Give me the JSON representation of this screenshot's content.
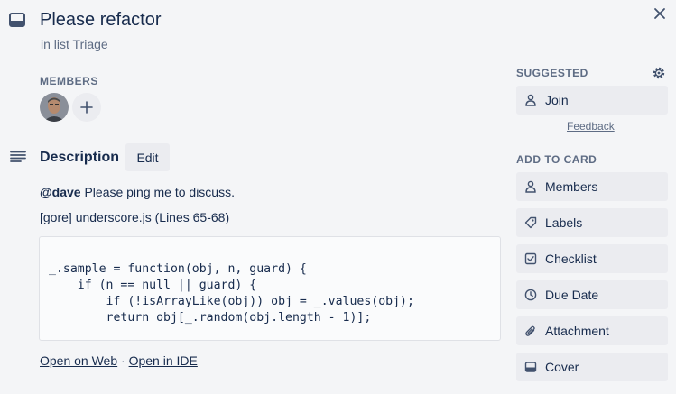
{
  "card": {
    "title": "Please refactor",
    "list_prefix": "in list",
    "list_name": "Triage"
  },
  "members": {
    "label": "MEMBERS"
  },
  "description": {
    "title": "Description",
    "edit_label": "Edit",
    "mention": "@dave",
    "message": "Please ping me to discuss.",
    "source_line": "[gore] underscore.js (Lines 65-68)",
    "code": "_.sample = function(obj, n, guard) {\n    if (n == null || guard) {\n        if (!isArrayLike(obj)) obj = _.values(obj);\n        return obj[_.random(obj.length - 1)];",
    "open_web": "Open on Web",
    "separator": "·",
    "open_ide": "Open in IDE"
  },
  "sidebar": {
    "suggested_label": "SUGGESTED",
    "join_label": "Join",
    "feedback_label": "Feedback",
    "add_to_card_label": "ADD TO CARD",
    "items": [
      {
        "label": "Members",
        "icon": "person-icon"
      },
      {
        "label": "Labels",
        "icon": "tag-icon"
      },
      {
        "label": "Checklist",
        "icon": "checklist-icon"
      },
      {
        "label": "Due Date",
        "icon": "clock-icon"
      },
      {
        "label": "Attachment",
        "icon": "paperclip-icon"
      },
      {
        "label": "Cover",
        "icon": "cover-icon"
      }
    ]
  },
  "colors": {
    "background": "#f4f5f7",
    "button_bg": "#ebecf0",
    "text": "#172b4d",
    "muted_text": "#5e6c84"
  }
}
